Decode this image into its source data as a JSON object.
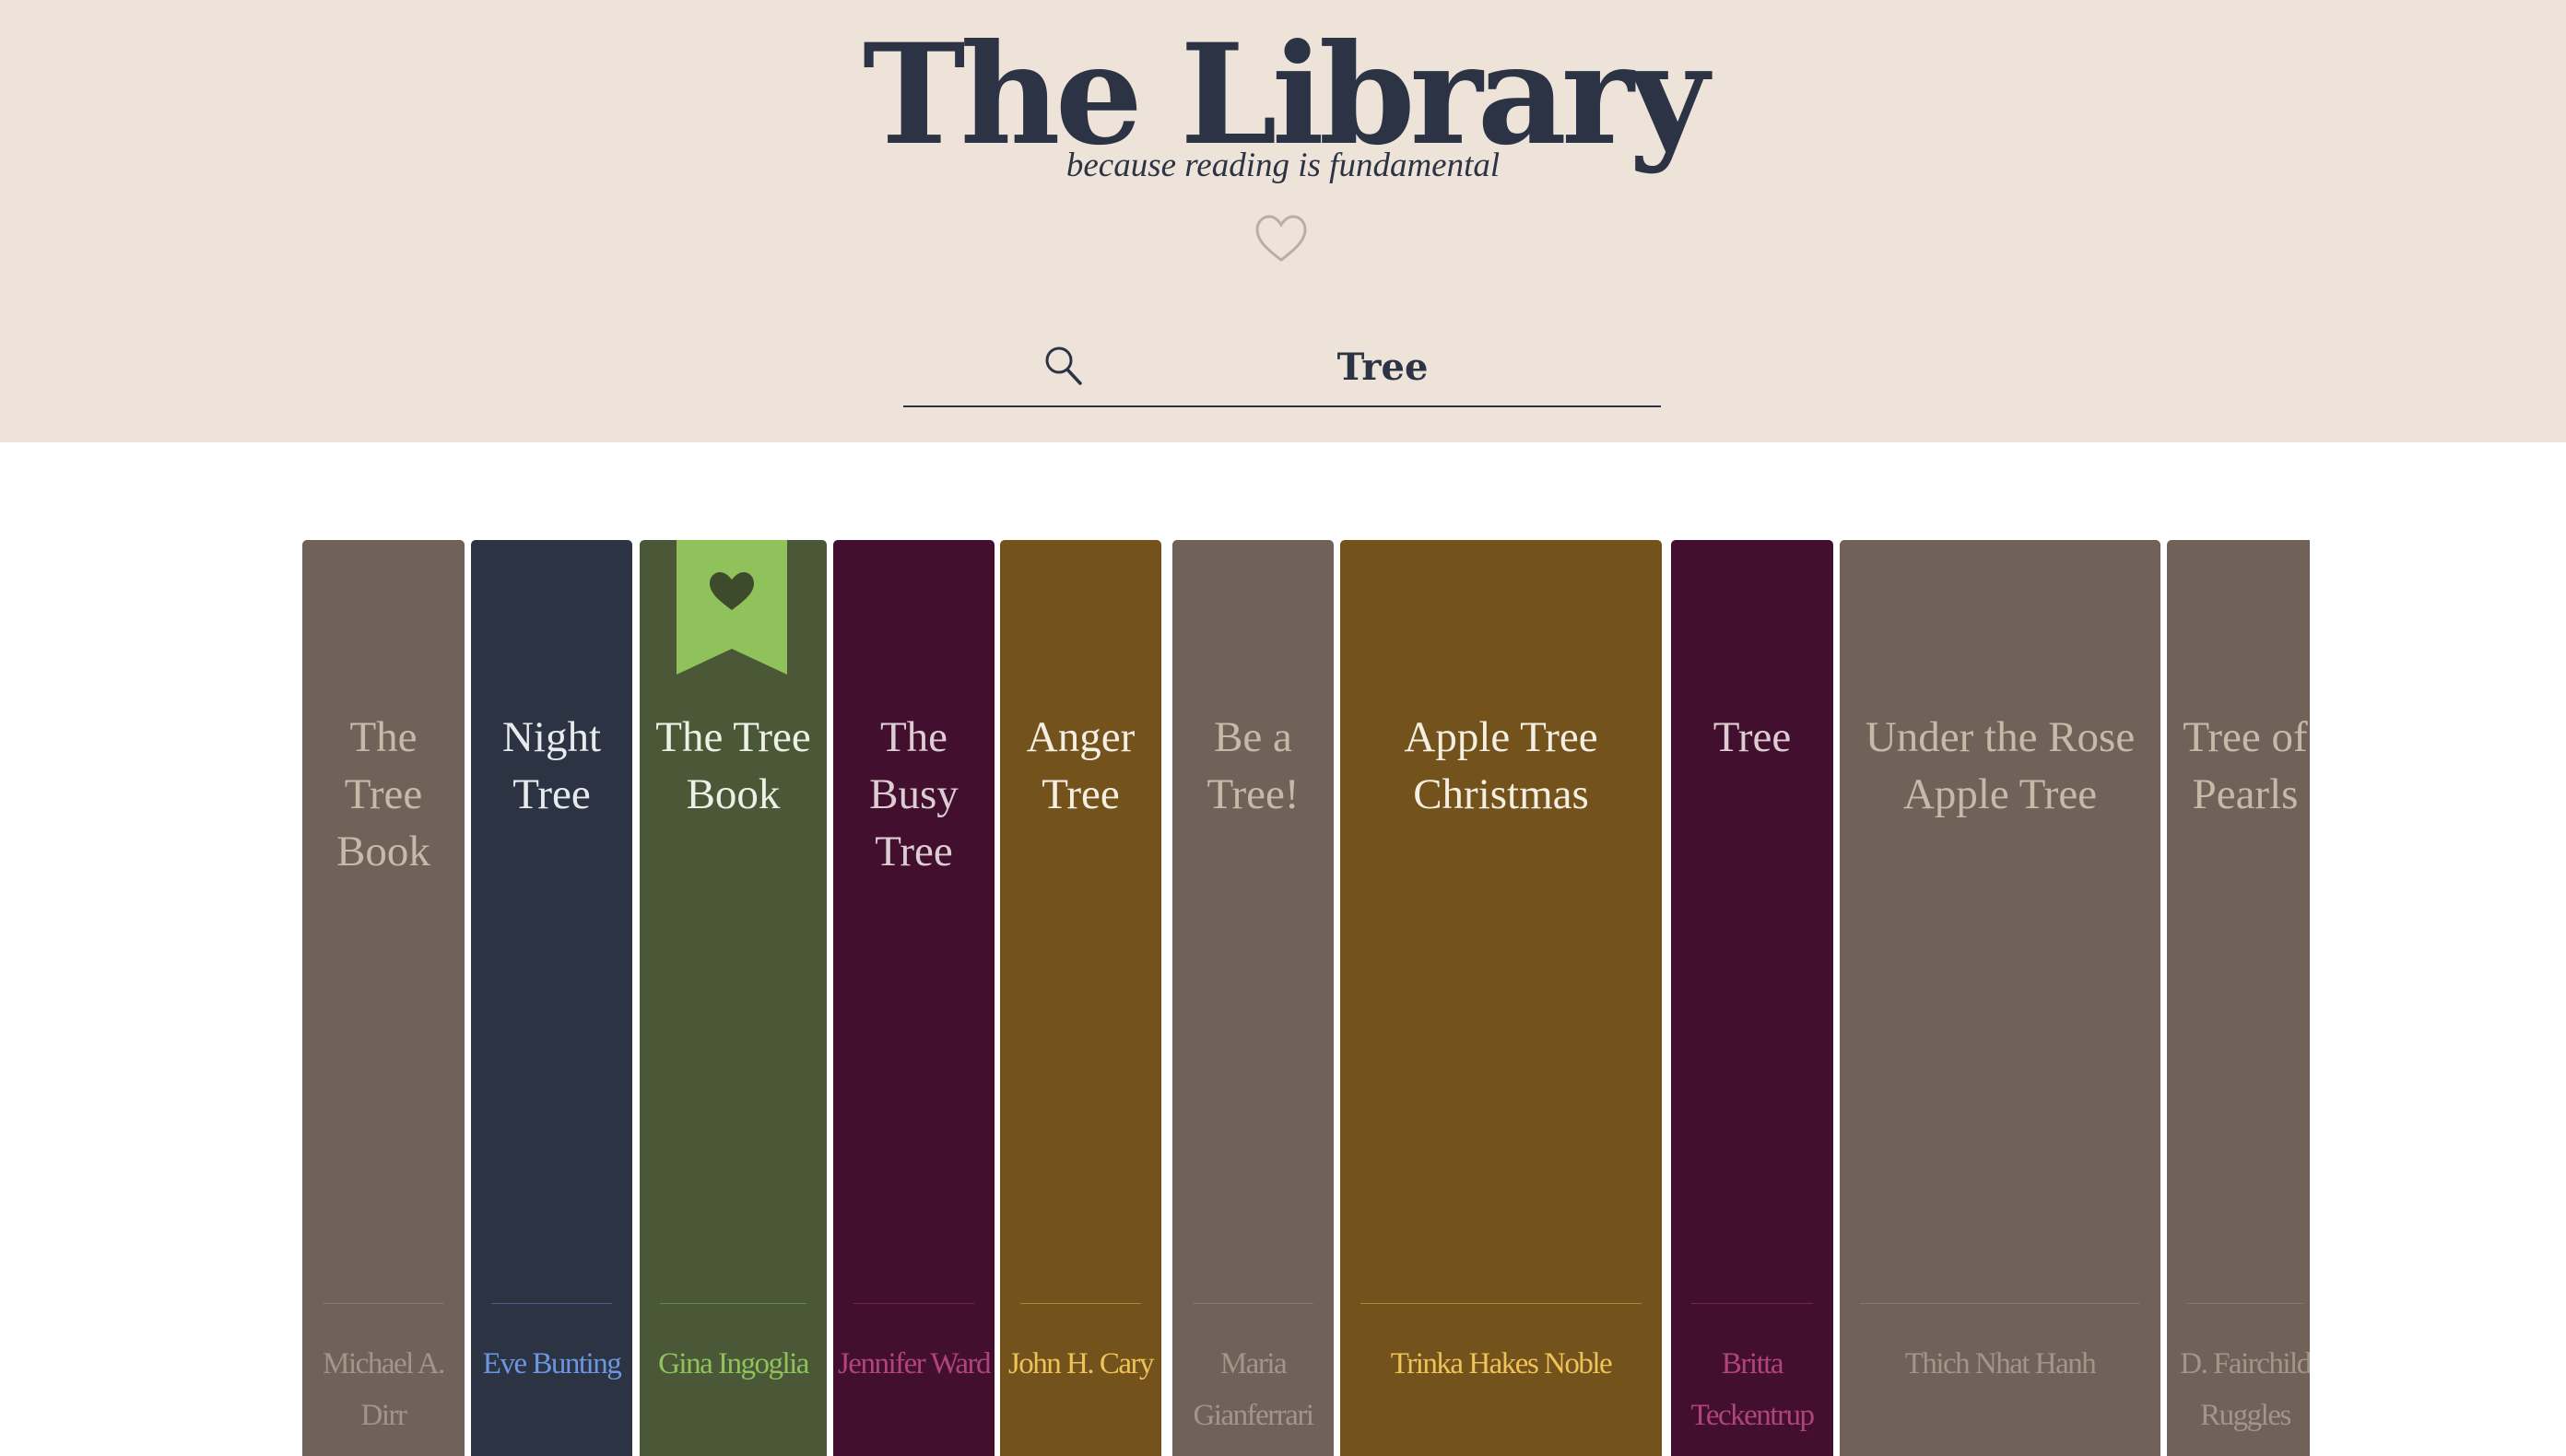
{
  "header": {
    "title": "The Library",
    "tagline": "because reading is fundamental",
    "favorites_icon": "heart-outline-icon"
  },
  "search": {
    "icon": "search-icon",
    "value": "Tree"
  },
  "colors": {
    "header_bg": "#ede3d8",
    "title": "#2b3344",
    "bookmark": "#8fc25a"
  },
  "books": [
    {
      "title": "The Tree Book",
      "author": "Michael A. Dirr",
      "spine": "#716259",
      "title_color": "#c8b8a8",
      "author_color": "#a2958a",
      "favorite": false
    },
    {
      "title": "Night Tree",
      "author": "Eve Bunting",
      "spine": "#2c3444",
      "title_color": "#e9eaee",
      "author_color": "#6c96e2",
      "favorite": false
    },
    {
      "title": "The Tree Book",
      "author": "Gina Ingoglia",
      "spine": "#4b5837",
      "title_color": "#eef0e6",
      "author_color": "#8fc25a",
      "favorite": true
    },
    {
      "title": "The Busy Tree",
      "author": "Jennifer Ward",
      "spine": "#430f2e",
      "title_color": "#dccdd3",
      "author_color": "#b0457c",
      "favorite": false
    },
    {
      "title": "Anger Tree",
      "author": "John H. Cary",
      "spine": "#73521c",
      "title_color": "#f5eee2",
      "author_color": "#efc35a",
      "favorite": false
    },
    {
      "title": "Be a Tree!",
      "author": "Maria Gianferrari",
      "spine": "#716259",
      "title_color": "#c8b8a8",
      "author_color": "#a2958a",
      "favorite": false
    },
    {
      "title": "Apple Tree Christmas",
      "author": "Trinka Hakes Noble",
      "spine": "#73521c",
      "title_color": "#f5eee2",
      "author_color": "#efc35a",
      "favorite": false
    },
    {
      "title": "Tree",
      "author": "Britta Teckentrup",
      "spine": "#430f2e",
      "title_color": "#dccdd3",
      "author_color": "#b0457c",
      "favorite": false
    },
    {
      "title": "Under the Rose Apple Tree",
      "author": "Thich Nhat Hanh",
      "spine": "#716259",
      "title_color": "#c8b8a8",
      "author_color": "#a2958a",
      "favorite": false
    },
    {
      "title": "Tree of Pearls",
      "author": "D. Fairchild Ruggles",
      "spine": "#716259",
      "title_color": "#c8b8a8",
      "author_color": "#a2958a",
      "favorite": false
    }
  ]
}
